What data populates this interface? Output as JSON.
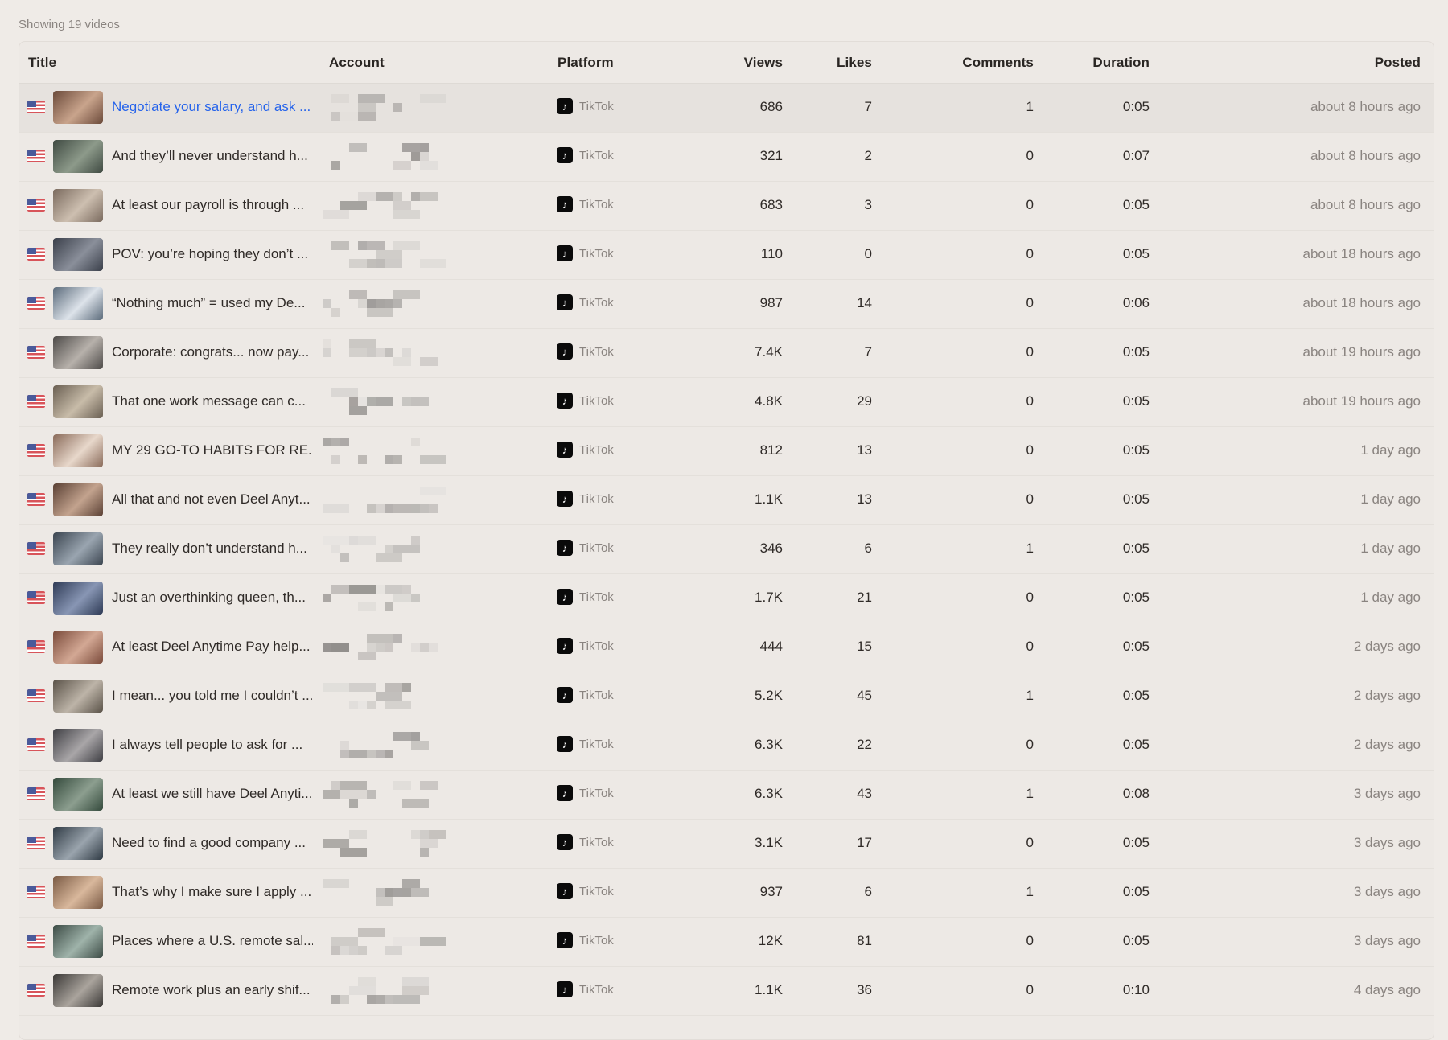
{
  "summary": "Showing 19 videos",
  "columns": {
    "title": "Title",
    "account": "Account",
    "platform": "Platform",
    "views": "Views",
    "likes": "Likes",
    "comments": "Comments",
    "duration": "Duration",
    "posted": "Posted"
  },
  "icons": {
    "flag": "us-flag-icon",
    "platform": "tiktok-icon"
  },
  "colors": {
    "link": "#2563eb",
    "background": "#efebe7",
    "muted": "#8a8480"
  },
  "rows": [
    {
      "title": "Negotiate your salary, and ask ...",
      "platform": "TikTok",
      "views": "686",
      "likes": "7",
      "comments": "1",
      "duration": "0:05",
      "posted": "about 8 hours ago",
      "highlighted": true
    },
    {
      "title": "And they’ll never understand h...",
      "platform": "TikTok",
      "views": "321",
      "likes": "2",
      "comments": "0",
      "duration": "0:07",
      "posted": "about 8 hours ago"
    },
    {
      "title": "At least our payroll is through ...",
      "platform": "TikTok",
      "views": "683",
      "likes": "3",
      "comments": "0",
      "duration": "0:05",
      "posted": "about 8 hours ago"
    },
    {
      "title": "POV: you’re hoping they don’t ...",
      "platform": "TikTok",
      "views": "110",
      "likes": "0",
      "comments": "0",
      "duration": "0:05",
      "posted": "about 18 hours ago"
    },
    {
      "title": "“Nothing much” = used my De...",
      "platform": "TikTok",
      "views": "987",
      "likes": "14",
      "comments": "0",
      "duration": "0:06",
      "posted": "about 18 hours ago"
    },
    {
      "title": "Corporate: congrats... now pay...",
      "platform": "TikTok",
      "views": "7.4K",
      "likes": "7",
      "comments": "0",
      "duration": "0:05",
      "posted": "about 19 hours ago"
    },
    {
      "title": "That one work message can c...",
      "platform": "TikTok",
      "views": "4.8K",
      "likes": "29",
      "comments": "0",
      "duration": "0:05",
      "posted": "about 19 hours ago"
    },
    {
      "title": "MY 29 GO-TO HABITS FOR RE...",
      "platform": "TikTok",
      "views": "812",
      "likes": "13",
      "comments": "0",
      "duration": "0:05",
      "posted": "1 day ago"
    },
    {
      "title": "All that and not even Deel Anyt...",
      "platform": "TikTok",
      "views": "1.1K",
      "likes": "13",
      "comments": "0",
      "duration": "0:05",
      "posted": "1 day ago"
    },
    {
      "title": "They really don’t understand h...",
      "platform": "TikTok",
      "views": "346",
      "likes": "6",
      "comments": "1",
      "duration": "0:05",
      "posted": "1 day ago"
    },
    {
      "title": "Just an overthinking queen, th...",
      "platform": "TikTok",
      "views": "1.7K",
      "likes": "21",
      "comments": "0",
      "duration": "0:05",
      "posted": "1 day ago"
    },
    {
      "title": "At least Deel Anytime Pay help...",
      "platform": "TikTok",
      "views": "444",
      "likes": "15",
      "comments": "0",
      "duration": "0:05",
      "posted": "2 days ago"
    },
    {
      "title": "I mean... you told me I couldn’t ...",
      "platform": "TikTok",
      "views": "5.2K",
      "likes": "45",
      "comments": "1",
      "duration": "0:05",
      "posted": "2 days ago"
    },
    {
      "title": "I always tell people to ask for ...",
      "platform": "TikTok",
      "views": "6.3K",
      "likes": "22",
      "comments": "0",
      "duration": "0:05",
      "posted": "2 days ago"
    },
    {
      "title": "At least we still have Deel Anyti...",
      "platform": "TikTok",
      "views": "6.3K",
      "likes": "43",
      "comments": "1",
      "duration": "0:08",
      "posted": "3 days ago"
    },
    {
      "title": "Need to find a good company ...",
      "platform": "TikTok",
      "views": "3.1K",
      "likes": "17",
      "comments": "0",
      "duration": "0:05",
      "posted": "3 days ago"
    },
    {
      "title": "That’s why I make sure I apply ...",
      "platform": "TikTok",
      "views": "937",
      "likes": "6",
      "comments": "1",
      "duration": "0:05",
      "posted": "3 days ago"
    },
    {
      "title": "Places where a U.S. remote sal...",
      "platform": "TikTok",
      "views": "12K",
      "likes": "81",
      "comments": "0",
      "duration": "0:05",
      "posted": "3 days ago"
    },
    {
      "title": "Remote work plus an early shif...",
      "platform": "TikTok",
      "views": "1.1K",
      "likes": "36",
      "comments": "0",
      "duration": "0:10",
      "posted": "4 days ago"
    }
  ]
}
